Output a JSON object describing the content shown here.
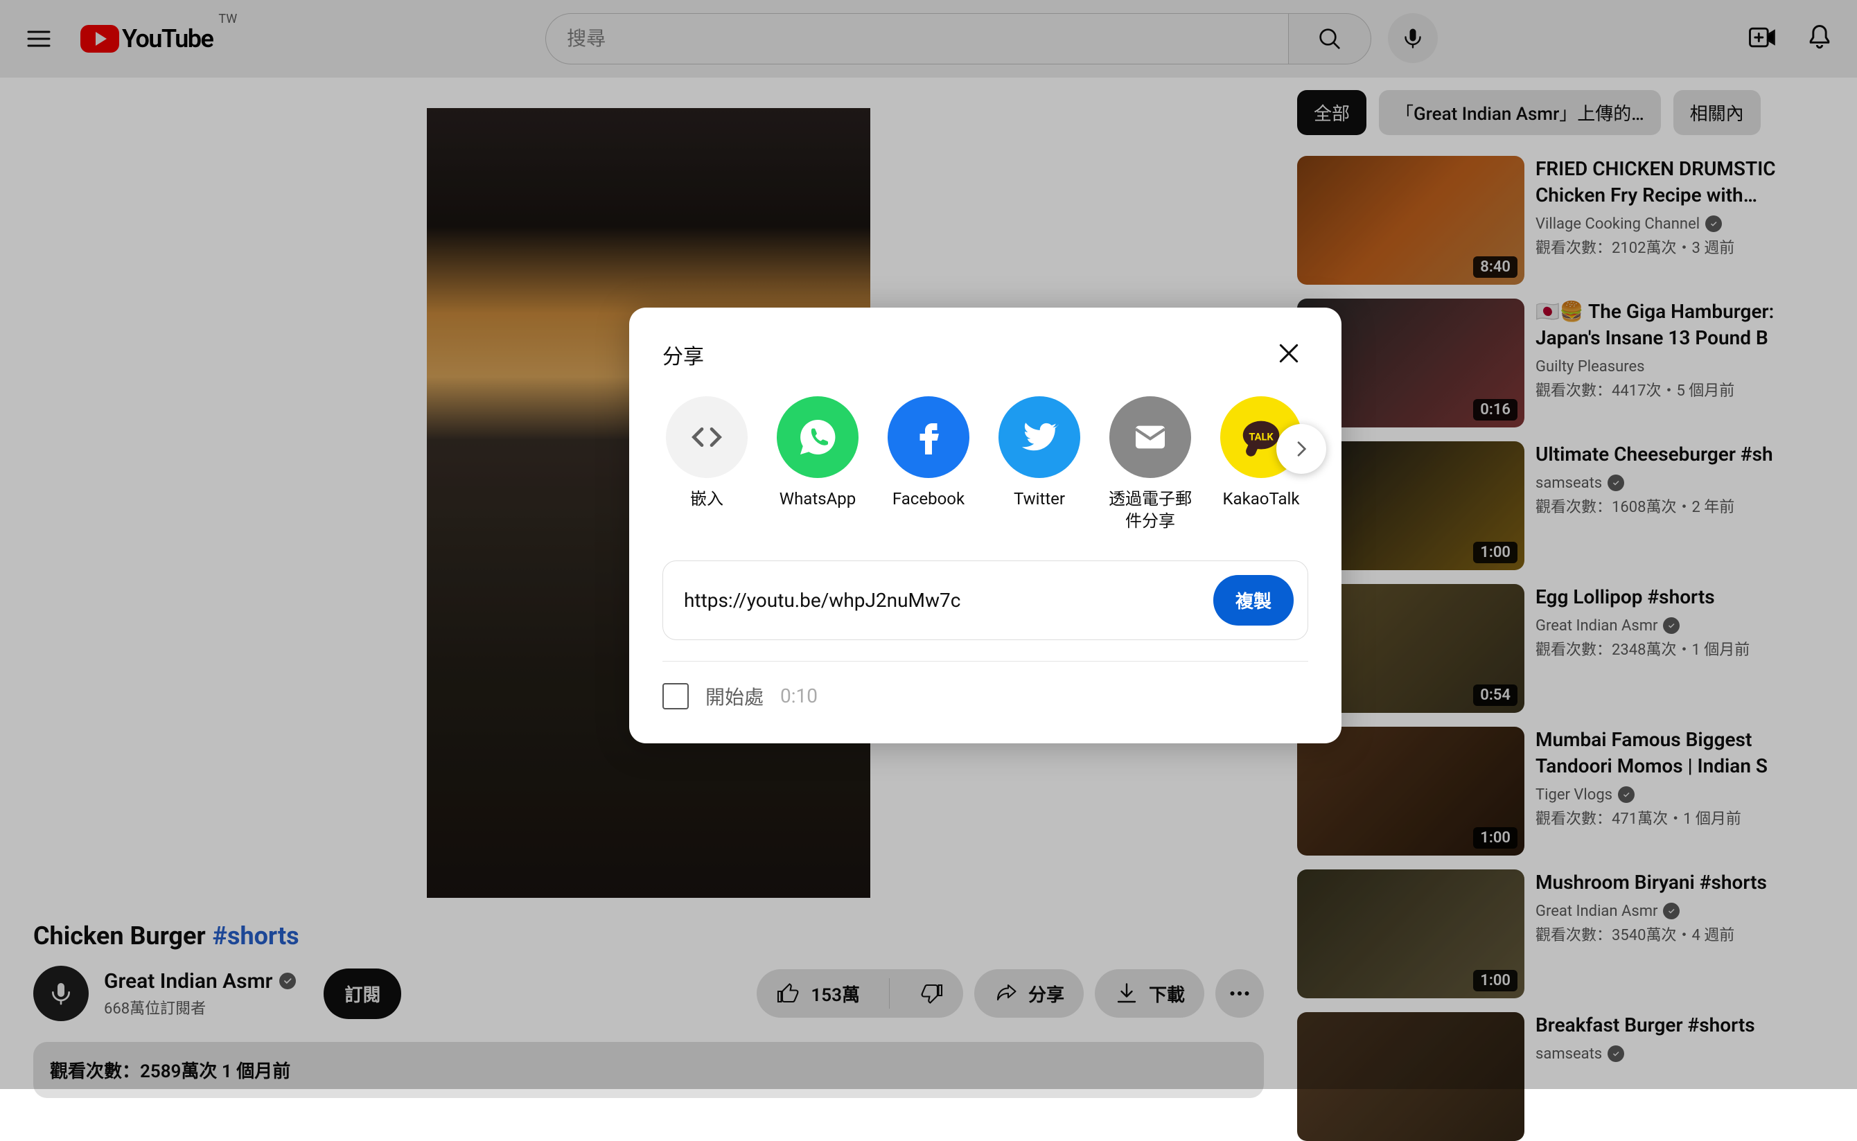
{
  "masthead": {
    "logo_text": "YouTube",
    "country_code": "TW",
    "search_placeholder": "搜尋"
  },
  "video": {
    "title": "Chicken Burger",
    "hashtag": "#shorts",
    "channel_name": "Great Indian Asmr",
    "subscribers": "668萬位訂閱者",
    "subscribe_label": "訂閱",
    "like_count": "153萬",
    "share_label": "分享",
    "download_label": "下載",
    "info_line": "觀看次數：2589萬次  1 個月前"
  },
  "secondary": {
    "chips": [
      {
        "label": "全部",
        "selected": true
      },
      {
        "label": "「Great Indian Asmr」上傳的…",
        "selected": false
      },
      {
        "label": "相關內",
        "selected": false
      }
    ],
    "recommendations": [
      {
        "title": "FRIED CHICKEN DRUMSTIC Chicken Fry Recipe with…",
        "channel": "Village Cooking Channel",
        "verified": true,
        "stats": "觀看次數：2102萬次・3 週前",
        "duration": "8:40"
      },
      {
        "title": "🇯🇵🍔 The Giga Hamburger: Japan's Insane 13 Pound B",
        "channel": "Guilty Pleasures",
        "verified": false,
        "stats": "觀看次數：4417次・5 個月前",
        "duration": "0:16"
      },
      {
        "title": "Ultimate Cheeseburger #sh",
        "channel": "samseats",
        "verified": true,
        "stats": "觀看次數：1608萬次・2 年前",
        "duration": "1:00"
      },
      {
        "title": "Egg Lollipop #shorts",
        "channel": "Great Indian Asmr",
        "verified": true,
        "stats": "觀看次數：2348萬次・1 個月前",
        "duration": "0:54"
      },
      {
        "title": "Mumbai Famous Biggest Tandoori Momos | Indian S",
        "channel": "Tiger Vlogs",
        "verified": true,
        "stats": "觀看次數：471萬次・1 個月前",
        "duration": "1:00"
      },
      {
        "title": "Mushroom Biryani #shorts",
        "channel": "Great Indian Asmr",
        "verified": true,
        "stats": "觀看次數：3540萬次・4 週前",
        "duration": "1:00"
      },
      {
        "title": "Breakfast Burger #shorts",
        "channel": "samseats",
        "verified": true,
        "stats": "",
        "duration": ""
      }
    ]
  },
  "share_dialog": {
    "title": "分享",
    "targets": [
      {
        "key": "embed",
        "label": "嵌入"
      },
      {
        "key": "whatsapp",
        "label": "WhatsApp"
      },
      {
        "key": "facebook",
        "label": "Facebook"
      },
      {
        "key": "twitter",
        "label": "Twitter"
      },
      {
        "key": "email",
        "label": "透過電子郵件分享"
      },
      {
        "key": "kakaotalk",
        "label": "KakaoTalk"
      }
    ],
    "url": "https://youtu.be/whpJ2nuMw7c",
    "copy_label": "複製",
    "start_at_label": "開始處",
    "start_at_time": "0:10"
  }
}
